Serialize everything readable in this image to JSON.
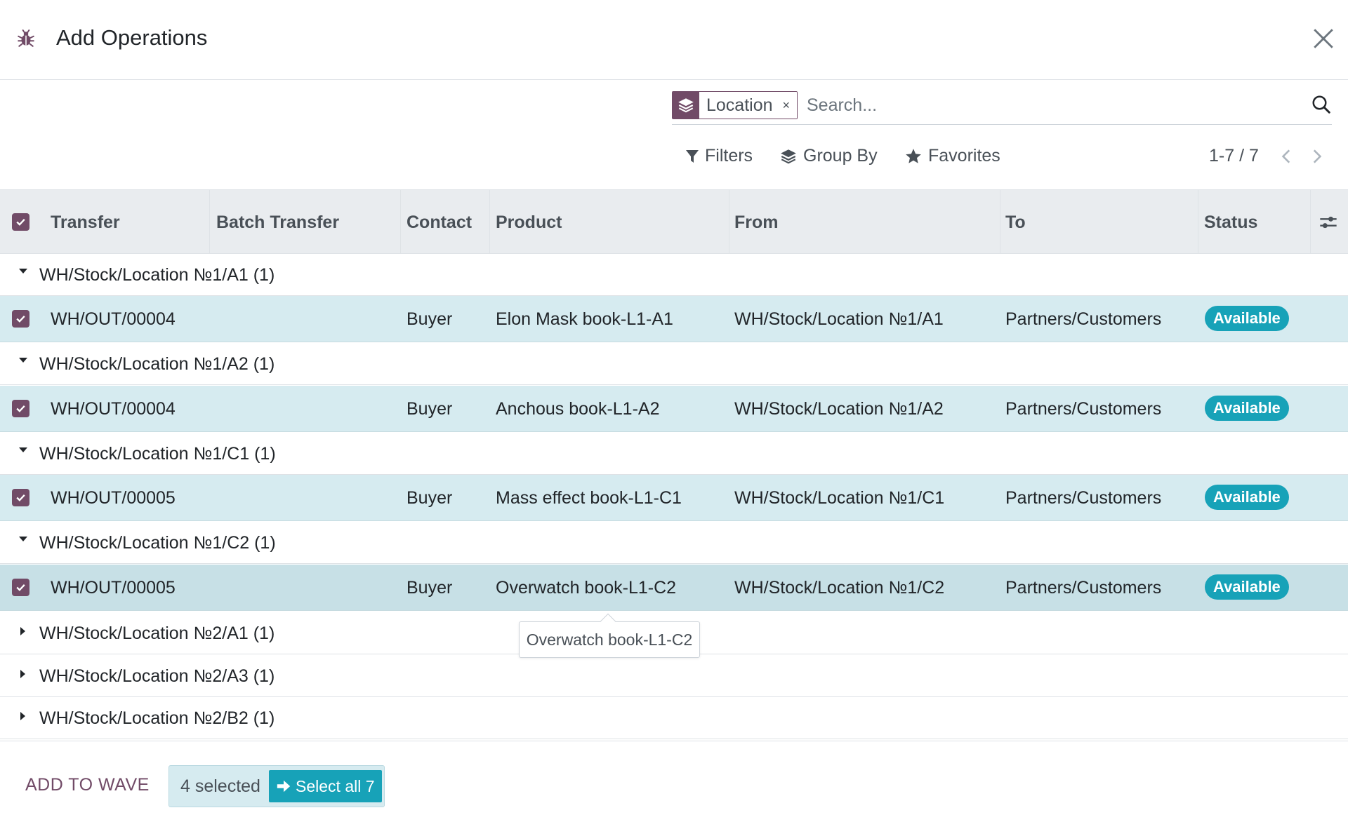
{
  "dialog": {
    "title": "Add Operations"
  },
  "search": {
    "facet_label": "Location",
    "facet_remove": "×",
    "placeholder": "Search..."
  },
  "toolbar": {
    "filters_label": "Filters",
    "groupby_label": "Group By",
    "favorites_label": "Favorites",
    "pager_value": "1-7 / 7"
  },
  "table": {
    "columns": [
      "Transfer",
      "Batch Transfer",
      "Contact",
      "Product",
      "From",
      "To",
      "Status"
    ],
    "groups": [
      {
        "label": "WH/Stock/Location №1/A1 (1)",
        "expanded": true,
        "rows": [
          {
            "transfer": "WH/OUT/00004",
            "batch": "",
            "contact": "Buyer",
            "product": "Elon Mask book-L1-A1",
            "from": "WH/Stock/Location №1/A1",
            "to": "Partners/Customers",
            "status": "Available"
          }
        ]
      },
      {
        "label": "WH/Stock/Location №1/A2 (1)",
        "expanded": true,
        "rows": [
          {
            "transfer": "WH/OUT/00004",
            "batch": "",
            "contact": "Buyer",
            "product": "Anchous book-L1-A2",
            "from": "WH/Stock/Location №1/A2",
            "to": "Partners/Customers",
            "status": "Available"
          }
        ]
      },
      {
        "label": "WH/Stock/Location №1/C1 (1)",
        "expanded": true,
        "rows": [
          {
            "transfer": "WH/OUT/00005",
            "batch": "",
            "contact": "Buyer",
            "product": "Mass effect book-L1-C1",
            "from": "WH/Stock/Location №1/C1",
            "to": "Partners/Customers",
            "status": "Available"
          }
        ]
      },
      {
        "label": "WH/Stock/Location №1/C2 (1)",
        "expanded": true,
        "rows": [
          {
            "transfer": "WH/OUT/00005",
            "batch": "",
            "contact": "Buyer",
            "product": "Overwatch book-L1-C2",
            "from": "WH/Stock/Location №1/C2",
            "to": "Partners/Customers",
            "status": "Available"
          }
        ]
      },
      {
        "label": "WH/Stock/Location №2/A1 (1)",
        "expanded": false,
        "rows": []
      },
      {
        "label": "WH/Stock/Location №2/A3 (1)",
        "expanded": false,
        "rows": []
      },
      {
        "label": "WH/Stock/Location №2/B2 (1)",
        "expanded": false,
        "rows": []
      }
    ]
  },
  "tooltip": {
    "text": "Overwatch book-L1-C2"
  },
  "footer": {
    "add_to_wave_label": "ADD TO WAVE",
    "selected_label": "4 selected",
    "select_all_label": "Select all 7"
  },
  "colors": {
    "brand": "#714b67",
    "accent": "#17a2b8",
    "selected_row": "#d6ebf0",
    "header_bg": "#e9ecef"
  }
}
